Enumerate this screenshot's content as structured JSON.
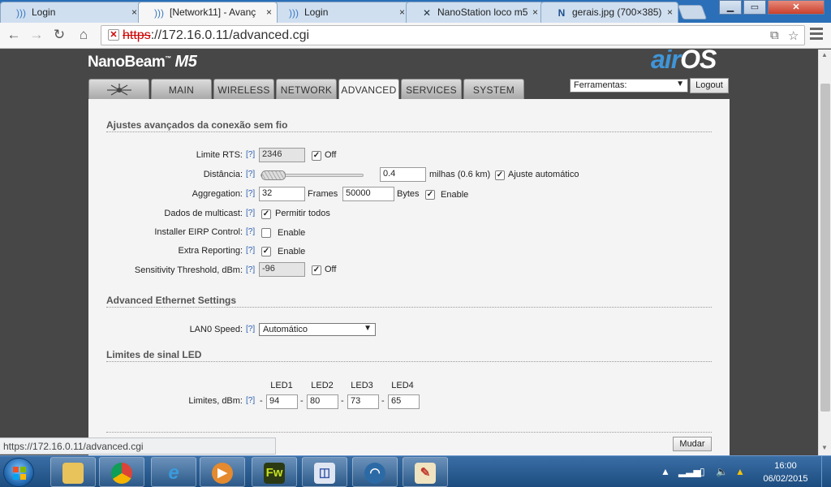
{
  "browser": {
    "tabs": [
      {
        "title": "Login",
        "icon": "signal-icon"
      },
      {
        "title": "[Network11] - Avanç",
        "icon": "signal-icon"
      },
      {
        "title": "Login",
        "icon": "signal-icon"
      },
      {
        "title": "NanoStation loco m5",
        "icon": "tool-icon"
      },
      {
        "title": "gerais.jpg (700×385)",
        "icon": "image-icon"
      }
    ],
    "tab_close": "×",
    "url_scheme": "https",
    "url_rest": "://172.16.0.11/advanced.cgi"
  },
  "brand": {
    "name": "NanoBeam",
    "model": "M5",
    "logo_air": "air",
    "logo_os": "OS"
  },
  "nav_tabs": [
    "",
    "MAIN",
    "WIRELESS",
    "NETWORK",
    "ADVANCED",
    "SERVICES",
    "SYSTEM"
  ],
  "tools": {
    "label": "Ferramentas:",
    "logout": "Logout"
  },
  "help_text": "[?]",
  "wireless": {
    "title": "Ajustes avançados da conexão sem fio",
    "rts": {
      "label": "Limite RTS:",
      "value": "2346",
      "off_label": "Off",
      "off_checked": true
    },
    "distance": {
      "label": "Distância:",
      "value": "0.4",
      "unit": "milhas (0.6 km)",
      "auto_label": "Ajuste automático",
      "auto_checked": true
    },
    "aggregation": {
      "label": "Aggregation:",
      "frames": "32",
      "frames_label": "Frames",
      "bytes": "50000",
      "bytes_label": "Bytes",
      "enable_label": "Enable",
      "enable_checked": true
    },
    "multicast": {
      "label": "Dados de multicast:",
      "option_label": "Permitir todos",
      "checked": true
    },
    "eirp": {
      "label": "Installer EIRP Control:",
      "enable_label": "Enable",
      "checked": false
    },
    "extra": {
      "label": "Extra Reporting:",
      "enable_label": "Enable",
      "checked": true
    },
    "sensitivity": {
      "label": "Sensitivity Threshold, dBm:",
      "value": "-96",
      "off_label": "Off",
      "off_checked": true
    }
  },
  "ethernet": {
    "title": "Advanced Ethernet Settings",
    "lan_speed": {
      "label": "LAN0 Speed:",
      "value": "Automático"
    }
  },
  "led": {
    "title": "Limites de sinal LED",
    "label": "Limites, dBm:",
    "headers": [
      "LED1",
      "LED2",
      "LED3",
      "LED4"
    ],
    "values": [
      "94",
      "80",
      "73",
      "65"
    ],
    "separator": "-"
  },
  "submit": "Mudar",
  "status_url": "https://172.16.0.11/advanced.cgi",
  "taskbar": {
    "apps": [
      "explorer",
      "chrome",
      "internet-explorer",
      "media",
      "fireworks",
      "remote-desktop",
      "network",
      "paint"
    ],
    "fw_label": "Fw",
    "time": "16:00",
    "date": "06/02/2015"
  },
  "colors": {
    "accent": "#2a5db0",
    "taskbar": "#1d4d80",
    "tabbar": "#2a6fb8"
  }
}
